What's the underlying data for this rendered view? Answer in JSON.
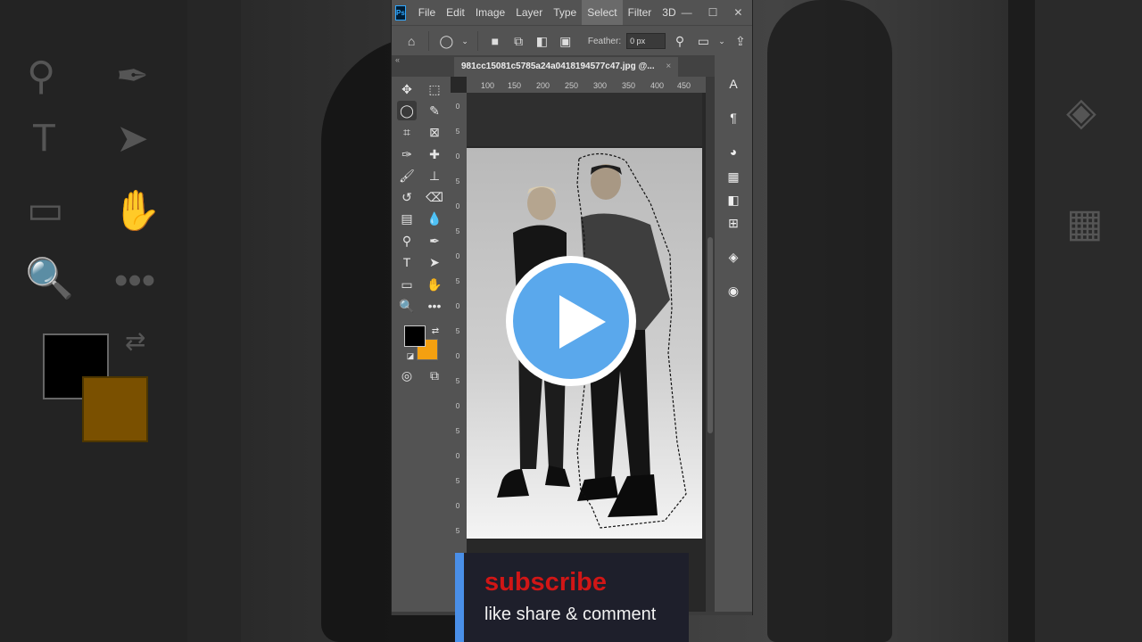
{
  "menu": {
    "app_logo": "Ps",
    "items": [
      "File",
      "Edit",
      "Image",
      "Layer",
      "Type",
      "Select",
      "Filter",
      "3D"
    ],
    "active": "Select"
  },
  "window_controls": {
    "minimize": "—",
    "maximize": "☐",
    "close": "✕"
  },
  "options_bar": {
    "feather_label": "Feather:",
    "feather_value": "0 px"
  },
  "document": {
    "tab_title": "981cc15081c5785a24a0418194577c47.jpg @...",
    "tab_close": "×"
  },
  "ruler": {
    "top_labels": [
      "100",
      "150",
      "200",
      "250",
      "300",
      "350",
      "400",
      "450"
    ],
    "left_labels": [
      "0",
      "5",
      "0",
      "5",
      "0",
      "5",
      "0",
      "5",
      "0",
      "5",
      "0",
      "5",
      "0",
      "5",
      "0",
      "5",
      "0",
      "5",
      "0",
      "5"
    ]
  },
  "colors": {
    "foreground": "#000000",
    "background": "#f4a010",
    "play_accent": "#5aa8ec",
    "subscribe_red": "#d11616"
  },
  "icons": {
    "tools": [
      "move-icon",
      "marquee-icon",
      "lasso-icon",
      "quick-select-icon",
      "crop-icon",
      "frame-icon",
      "eyedropper-icon",
      "healing-icon",
      "brush-icon",
      "stamp-icon",
      "history-brush-icon",
      "eraser-icon",
      "gradient-icon",
      "blur-icon",
      "dodge-icon",
      "pen-icon",
      "type-icon",
      "path-select-icon",
      "rectangle-icon",
      "hand-icon",
      "zoom-icon",
      "more-icon"
    ],
    "panels": [
      "character-icon",
      "paragraph-icon",
      "color-icon",
      "swatches-icon",
      "gradients-icon",
      "patterns-icon",
      "layers-icon",
      "properties-icon"
    ]
  },
  "overlay": {
    "subscribe_title": "subscribe",
    "subscribe_text": "like share & comment"
  }
}
